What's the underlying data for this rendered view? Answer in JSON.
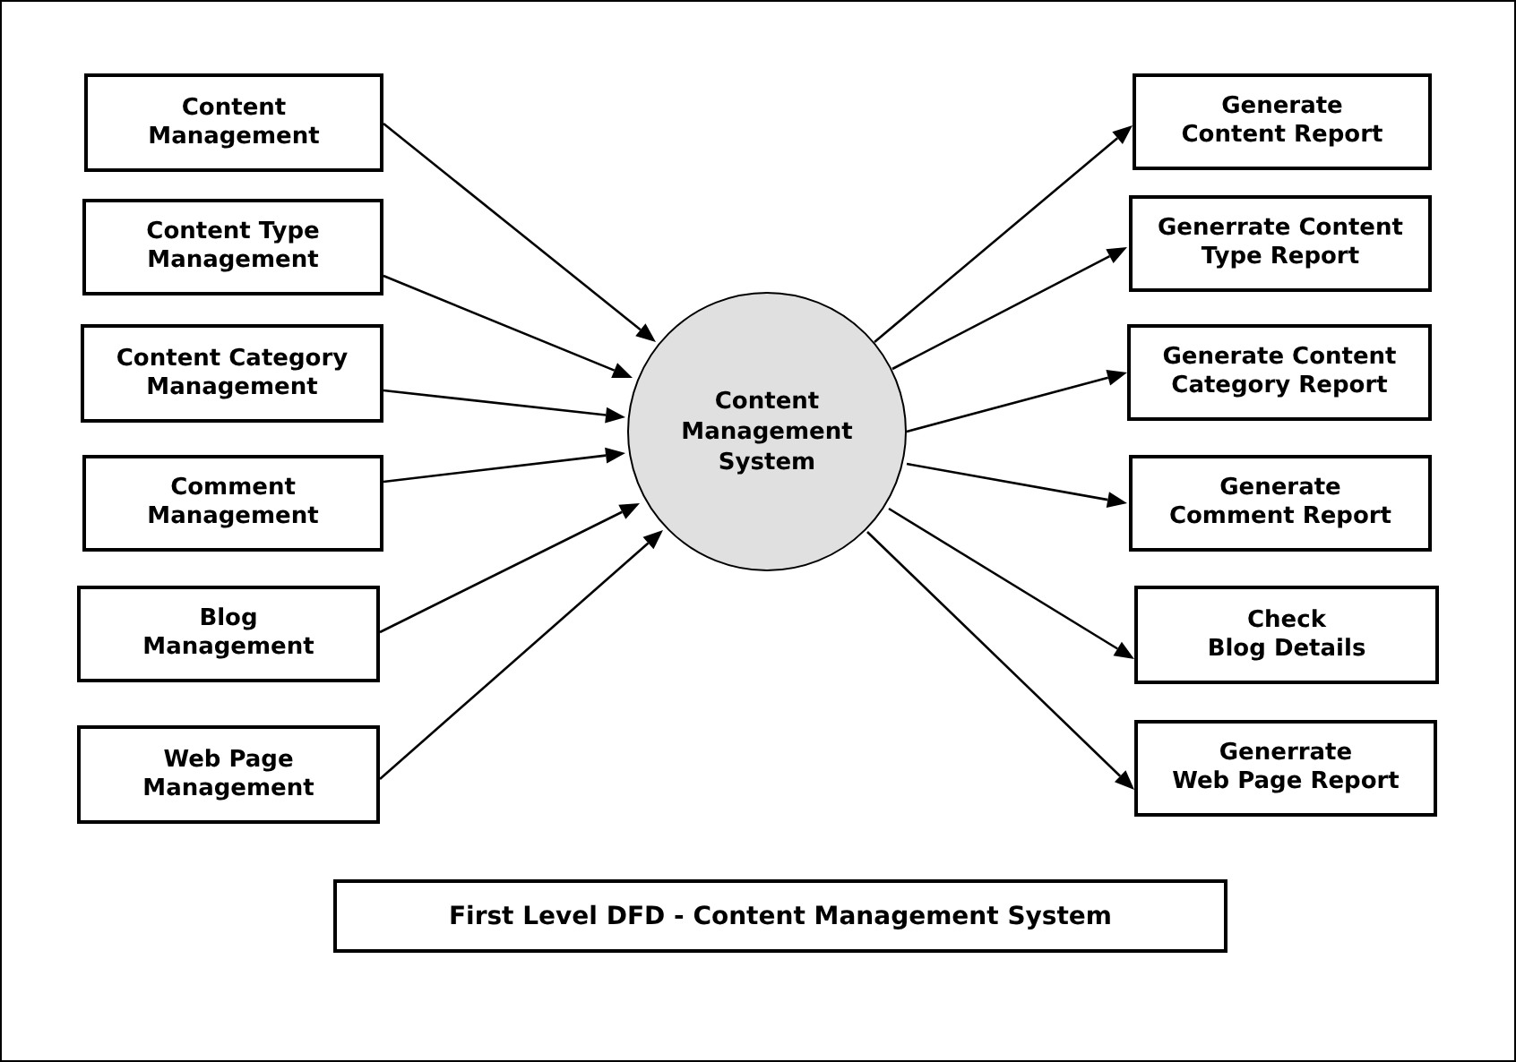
{
  "diagram": {
    "inputs": [
      {
        "label": "Content\nManagement"
      },
      {
        "label": "Content Type\nManagement"
      },
      {
        "label": "Content Category\nManagement"
      },
      {
        "label": "Comment\nManagement"
      },
      {
        "label": "Blog\nManagement"
      },
      {
        "label": "Web Page\nManagement"
      }
    ],
    "process": {
      "label": "Content\nManagement\nSystem"
    },
    "outputs": [
      {
        "label": "Generate\nContent Report"
      },
      {
        "label": "Generrate Content\nType Report"
      },
      {
        "label": "Generate Content\nCategory Report"
      },
      {
        "label": "Generate\nComment Report"
      },
      {
        "label": "Check\nBlog Details"
      },
      {
        "label": "Generrate\nWeb Page Report"
      }
    ]
  },
  "caption": "First Level DFD - Content Management System"
}
